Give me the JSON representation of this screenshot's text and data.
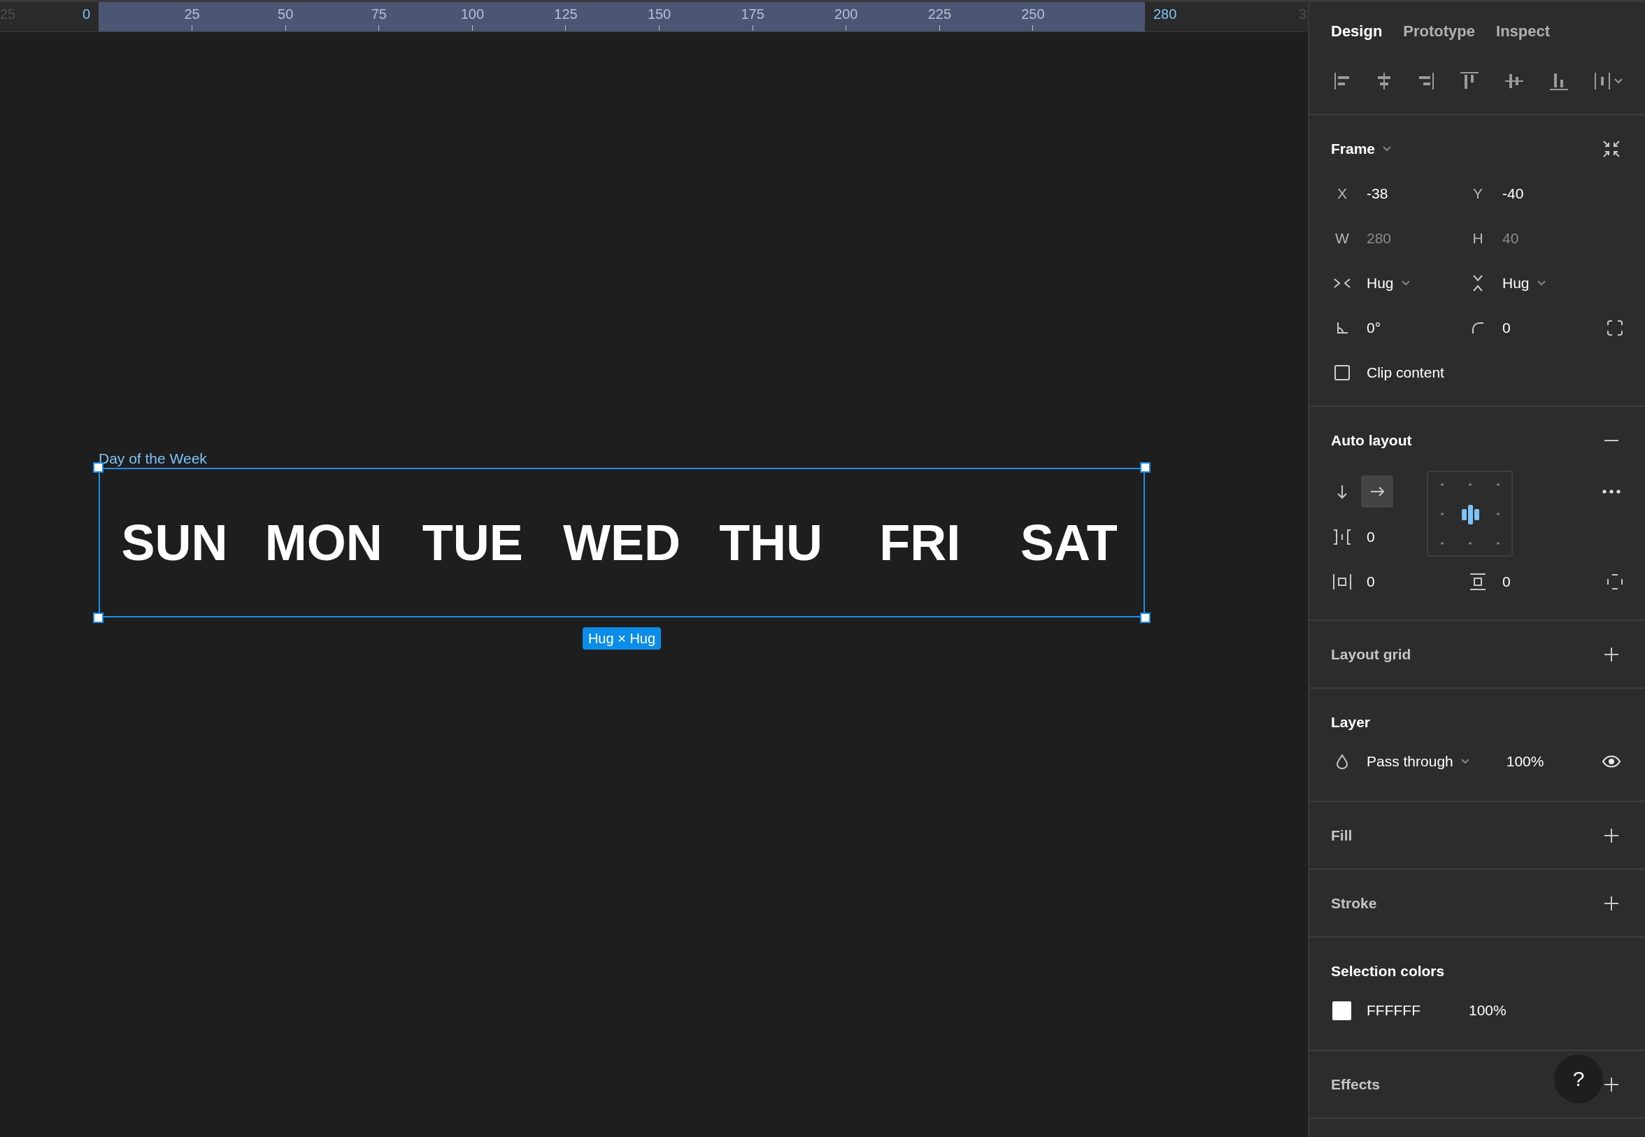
{
  "ruler": {
    "labels": [
      {
        "text": "25",
        "kind": "offscreen"
      },
      {
        "text": "0",
        "kind": "bound"
      },
      {
        "text": "25",
        "kind": "tick"
      },
      {
        "text": "50",
        "kind": "tick"
      },
      {
        "text": "75",
        "kind": "tick"
      },
      {
        "text": "100",
        "kind": "tick"
      },
      {
        "text": "125",
        "kind": "tick"
      },
      {
        "text": "150",
        "kind": "tick"
      },
      {
        "text": "175",
        "kind": "tick"
      },
      {
        "text": "200",
        "kind": "tick"
      },
      {
        "text": "225",
        "kind": "tick"
      },
      {
        "text": "250",
        "kind": "tick"
      },
      {
        "text": "280",
        "kind": "bound"
      },
      {
        "text": "3",
        "kind": "offscreen"
      }
    ]
  },
  "canvas": {
    "frame": {
      "label": "Day of the Week",
      "selected": true,
      "days": [
        "SUN",
        "MON",
        "TUE",
        "WED",
        "THU",
        "FRI",
        "SAT"
      ],
      "size_badge": "Hug × Hug"
    }
  },
  "panel": {
    "tabs": [
      {
        "label": "Design",
        "selected": true
      },
      {
        "label": "Prototype",
        "selected": false
      },
      {
        "label": "Inspect",
        "selected": false
      }
    ],
    "sections": [
      {
        "kind": "frame",
        "title": "Frame",
        "fields": [
          {
            "kind": "letter",
            "label": "X",
            "value": "-38",
            "disabled": false
          },
          {
            "kind": "letter",
            "label": "Y",
            "value": "-40",
            "disabled": false
          },
          {
            "kind": "letter",
            "label": "W",
            "value": "280",
            "disabled": true
          },
          {
            "kind": "letter",
            "label": "H",
            "value": "40",
            "disabled": true
          },
          {
            "kind": "horizontal-sizing",
            "value": "Hug",
            "dropdown": true,
            "disabled": false
          },
          {
            "kind": "vertical-sizing",
            "value": "Hug",
            "dropdown": true,
            "disabled": false
          },
          {
            "kind": "rotation",
            "value": "0°",
            "disabled": false
          },
          {
            "kind": "corner-radius",
            "value": "0",
            "disabled": false
          }
        ],
        "clip_content": {
          "label": "Clip content",
          "checked": false
        }
      },
      {
        "kind": "auto_layout",
        "title": "Auto layout",
        "directions": [
          {
            "kind": "vertical",
            "selected": false
          },
          {
            "kind": "horizontal",
            "selected": true
          }
        ],
        "gap": {
          "kind": "gap",
          "value": "0",
          "disabled": false
        },
        "padding": [
          {
            "kind": "horizontal-padding",
            "value": "0",
            "disabled": false
          },
          {
            "kind": "vertical-padding",
            "value": "0",
            "disabled": false
          }
        ]
      },
      {
        "kind": "empty",
        "title": "Layout grid"
      },
      {
        "kind": "layer",
        "title": "Layer",
        "blend_mode": "Pass through",
        "opacity": "100%",
        "visible": true
      },
      {
        "kind": "empty",
        "title": "Fill"
      },
      {
        "kind": "empty",
        "title": "Stroke"
      },
      {
        "kind": "selection_colors",
        "title": "Selection colors",
        "colors": [
          {
            "color": "#ffffff",
            "hex": "FFFFFF",
            "opacity": "100%"
          }
        ]
      },
      {
        "kind": "empty",
        "title": "Effects"
      }
    ],
    "help_button": {
      "label": "?"
    }
  }
}
